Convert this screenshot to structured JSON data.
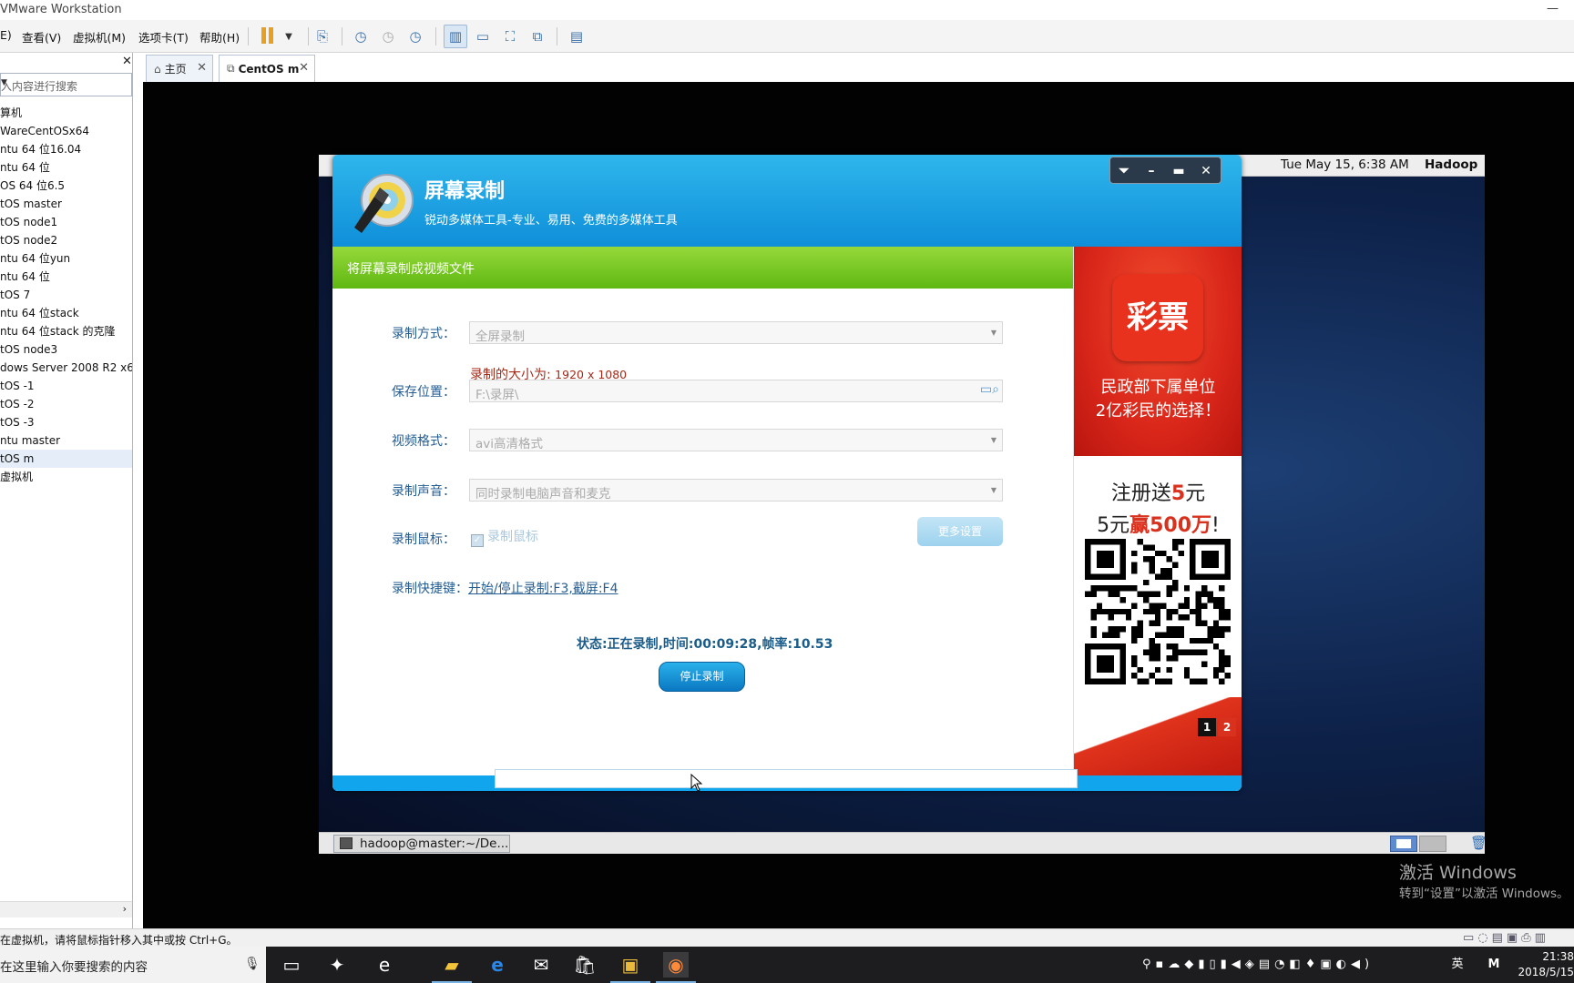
{
  "window": {
    "title": "VMware Workstation",
    "minimize": "—"
  },
  "menu": {
    "items": [
      "E)",
      "查看(V)",
      "虚拟机(M)",
      "选项卡(T)",
      "帮助(H)"
    ]
  },
  "library": {
    "close": "✕",
    "search_placeholder": "入内容进行搜索",
    "items": [
      "算机",
      "WareCentOSx64",
      "ntu 64 位16.04",
      "ntu 64 位",
      "OS 64 位6.5",
      "tOS master",
      "tOS node1",
      "tOS node2",
      "ntu 64 位yun",
      "ntu 64 位",
      "tOS 7",
      "ntu 64 位stack",
      "ntu 64 位stack 的克隆",
      "tOS node3",
      "dows Server 2008 R2 x64",
      "tOS -1",
      "tOS -2",
      "tOS -3",
      "ntu master",
      "tOS m",
      "虚拟机"
    ],
    "selected_index": 19
  },
  "tabs": [
    {
      "label": "主页",
      "close": "✕"
    },
    {
      "label": "CentOS m",
      "close": "✕"
    }
  ],
  "guest": {
    "clock": "Tue May 15,  6:38 AM",
    "user": "Hadoop",
    "taskbar_item": "hadoop@master:~/De..."
  },
  "recorder": {
    "title": "屏幕录制",
    "subtitle": "锐动多媒体工具-专业、易用、免费的多媒体工具",
    "section": "将屏幕录制成视频文件",
    "mode_label": "录制方式：",
    "mode_value": "全屏录制",
    "size_label": "录制的大小为: ",
    "size_value": "1920 x 1080",
    "save_label": "保存位置：",
    "save_value": "F:\\录屏\\",
    "format_label": "视频格式：",
    "format_value": "avi高清格式",
    "audio_label": "录制声音：",
    "audio_value": "同时录制电脑声音和麦克",
    "mouse_label": "录制鼠标：",
    "mouse_checkbox": "录制鼠标",
    "more_settings": "更多设置",
    "hotkey_label": "录制快捷键：",
    "hotkey_value": "开始/停止录制:F3,截屏:F4",
    "status": "状态:正在录制,时间:00:09:28,帧率:10.53",
    "stop": "停止录制"
  },
  "ad": {
    "logo_text": "彩票",
    "line1": "民政部下属单位",
    "line2": "2亿彩民的选择！",
    "line3_a": "注册送",
    "line3_b": "5",
    "line3_c": "元",
    "line4_a": "5元",
    "line4_b": "赢500万",
    "line4_c": "!",
    "page1": "1",
    "page2": "2"
  },
  "watermark": {
    "line1": "激活 Windows",
    "line2": "转到“设置”以激活 Windows。"
  },
  "vm_status": "在虚拟机，请将鼠标指针移入其中或按 Ctrl+G。",
  "taskbar": {
    "search_placeholder": "在这里输入你要搜索的内容",
    "ime": "英",
    "ime2": "M",
    "time": "21:38",
    "date": "2018/5/15"
  },
  "colors": {
    "accent_blue": "#0f8fd9",
    "green_bar": "#5fb812",
    "ad_red": "#d9261a"
  }
}
